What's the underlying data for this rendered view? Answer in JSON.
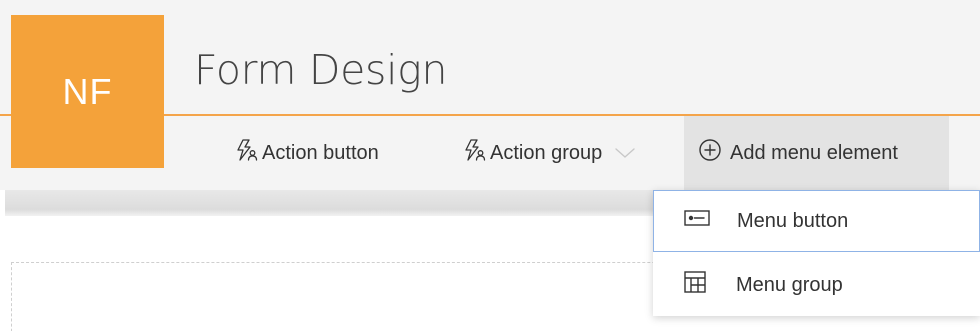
{
  "app": {
    "logo_text": "NF",
    "title": "Form Design"
  },
  "toolbar": {
    "action_button_label": "Action button",
    "action_group_label": "Action group",
    "add_menu_element_label": "Add menu element"
  },
  "dropdown": {
    "items": [
      {
        "label": "Menu button",
        "icon": "menu-button-icon"
      },
      {
        "label": "Menu group",
        "icon": "menu-group-icon"
      }
    ]
  },
  "colors": {
    "accent": "#f4a23a",
    "accent_line": "#f4a44a",
    "header_background": "#f4f4f4",
    "text": "#333333",
    "focus_border": "#8fb3e6"
  }
}
